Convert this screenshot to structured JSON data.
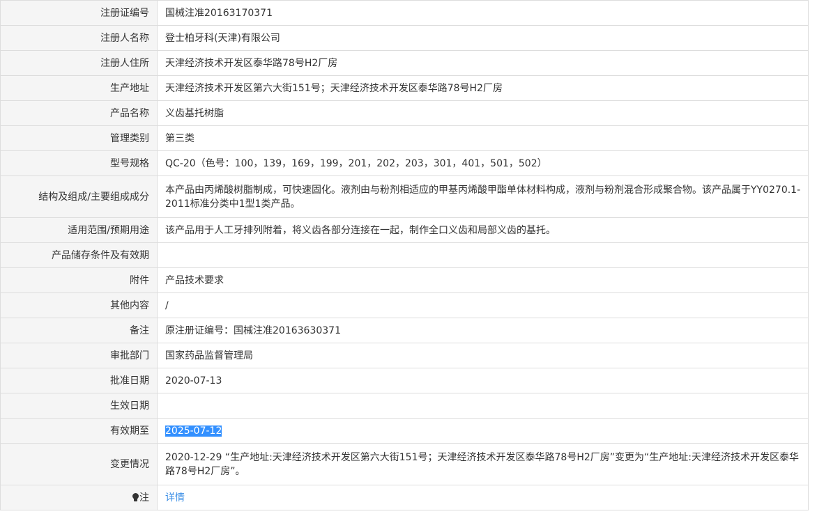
{
  "rows": [
    {
      "label": "注册证编号",
      "value": "国械注准20163170371"
    },
    {
      "label": "注册人名称",
      "value": "登士柏牙科(天津)有限公司"
    },
    {
      "label": "注册人住所",
      "value": "天津经济技术开发区泰华路78号H2厂房"
    },
    {
      "label": "生产地址",
      "value": "天津经济技术开发区第六大街151号；天津经济技术开发区泰华路78号H2厂房"
    },
    {
      "label": "产品名称",
      "value": "义齿基托树脂"
    },
    {
      "label": "管理类别",
      "value": "第三类"
    },
    {
      "label": "型号规格",
      "value": "QC-20（色号：100，139，169，199，201，202，203，301，401，501，502）"
    },
    {
      "label": "结构及组成/主要组成成分",
      "value": "本产品由丙烯酸树脂制成，可快速固化。液剂由与粉剂相适应的甲基丙烯酸甲酯单体材料构成，液剂与粉剂混合形成聚合物。该产品属于YY0270.1-2011标准分类中1型1类产品。"
    },
    {
      "label": "适用范围/预期用途",
      "value": "该产品用于人工牙排列附着，将义齿各部分连接在一起，制作全口义齿和局部义齿的基托。"
    },
    {
      "label": "产品储存条件及有效期",
      "value": ""
    },
    {
      "label": "附件",
      "value": "产品技术要求"
    },
    {
      "label": "其他内容",
      "value": "/"
    },
    {
      "label": "备注",
      "value": "原注册证编号：国械注准20163630371"
    },
    {
      "label": "审批部门",
      "value": "国家药品监督管理局"
    },
    {
      "label": "批准日期",
      "value": "2020-07-13"
    },
    {
      "label": "生效日期",
      "value": ""
    },
    {
      "label": "有效期至",
      "value": "2025-07-12"
    },
    {
      "label": "变更情况",
      "value": "2020-12-29 “生产地址:天津经济技术开发区第六大街151号；天津经济技术开发区泰华路78号H2厂房”变更为“生产地址:天津经济技术开发区泰华路78号H2厂房”。"
    }
  ],
  "note": {
    "label": "注",
    "icon": "lightbulb-icon",
    "link_text": "详情"
  },
  "colors": {
    "label_bg": "#f5f5f5",
    "border": "#dddddd",
    "selection": "#3390ff",
    "link": "#3a8ee6"
  }
}
